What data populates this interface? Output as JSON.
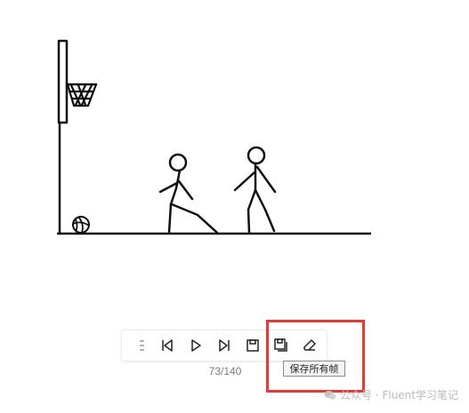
{
  "frame_counter": "73/140",
  "tooltip": "保存所有帧",
  "toolbar": {
    "buttons": [
      {
        "name": "menu-icon"
      },
      {
        "name": "first-frame-icon"
      },
      {
        "name": "play-icon"
      },
      {
        "name": "last-frame-icon"
      },
      {
        "name": "save-frame-icon"
      },
      {
        "name": "save-all-frames-icon"
      },
      {
        "name": "eraser-icon"
      }
    ]
  },
  "colors": {
    "highlight": "#e53935",
    "ink": "#111111"
  },
  "watermark": "公众号 · Fluent学习笔记"
}
